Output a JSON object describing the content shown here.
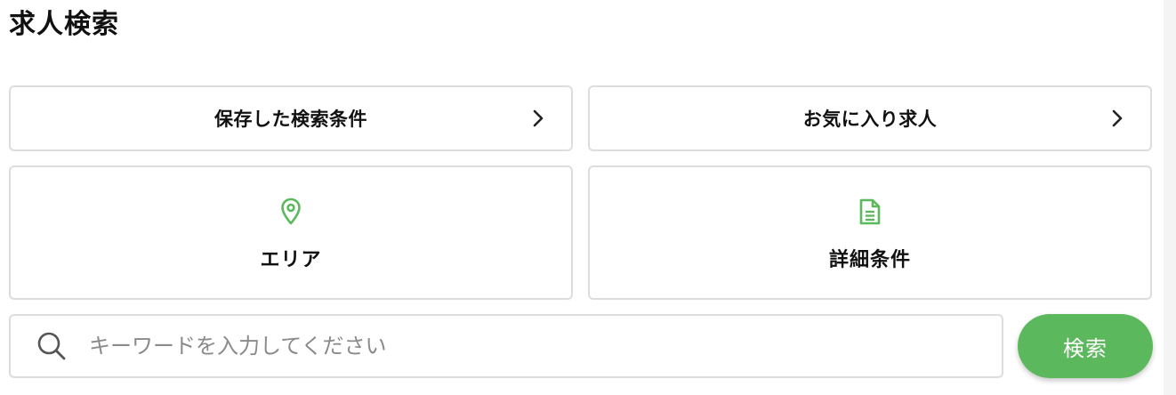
{
  "header": {
    "title": "求人検索"
  },
  "quick_links": [
    {
      "label": "保存した検索条件",
      "icon": "chevron-right-icon"
    },
    {
      "label": "お気に入り求人",
      "icon": "chevron-right-icon"
    }
  ],
  "filters": [
    {
      "label": "エリア",
      "icon": "location-pin-icon"
    },
    {
      "label": "詳細条件",
      "icon": "document-icon"
    }
  ],
  "search": {
    "placeholder": "キーワードを入力してください",
    "value": "",
    "button_label": "検索",
    "icon": "search-icon"
  },
  "colors": {
    "accent": "#5cb85c",
    "border": "#dddddd",
    "text": "#111111",
    "placeholder": "#8a8a8a"
  }
}
